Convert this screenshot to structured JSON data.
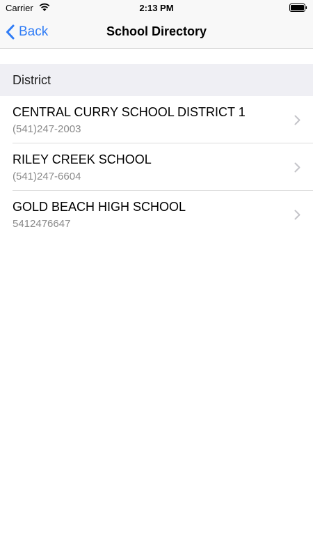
{
  "status_bar": {
    "carrier": "Carrier",
    "time": "2:13 PM"
  },
  "nav": {
    "back_label": "Back",
    "title": "School Directory"
  },
  "section": {
    "header": "District"
  },
  "schools": [
    {
      "name": "CENTRAL CURRY SCHOOL DISTRICT 1",
      "phone": "(541)247-2003"
    },
    {
      "name": "RILEY CREEK SCHOOL",
      "phone": "(541)247-6604"
    },
    {
      "name": "GOLD BEACH HIGH SCHOOL",
      "phone": "5412476647"
    }
  ],
  "colors": {
    "accent": "#2f7cf6",
    "secondary_text": "#8a8a8a",
    "section_background": "#efeff4"
  },
  "icons": {
    "wifi": "wifi-icon",
    "battery": "battery-icon",
    "back": "chevron-left-icon",
    "disclosure": "chevron-right-icon"
  }
}
